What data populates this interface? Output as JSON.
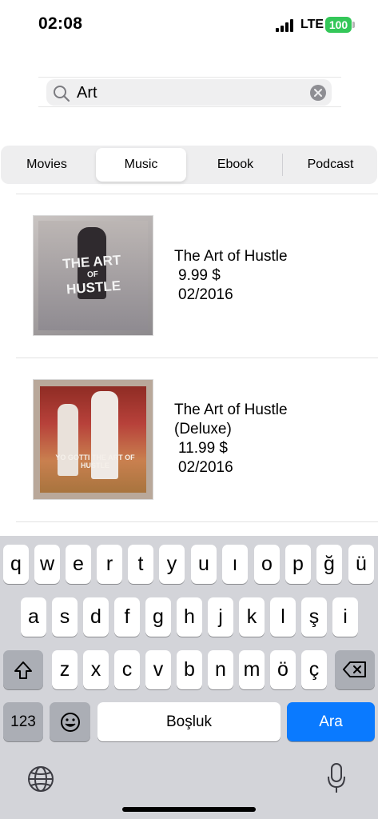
{
  "status_bar": {
    "time": "02:08",
    "network": "LTE",
    "battery": "100",
    "battery_color": "#34c759"
  },
  "search": {
    "value": "Art",
    "icon": "search-icon",
    "clear_icon": "clear-icon"
  },
  "segments": {
    "items": [
      {
        "label": "Movies",
        "selected": false
      },
      {
        "label": "Music",
        "selected": true
      },
      {
        "label": "Ebook",
        "selected": false
      },
      {
        "label": "Podcast",
        "selected": false
      }
    ]
  },
  "results": [
    {
      "title": "The Art of Hustle",
      "price": "9.99 $",
      "date": "02/2016",
      "artwork_text": [
        "THE ART",
        "OF",
        "HUSTLE"
      ]
    },
    {
      "title": "The Art of Hustle",
      "title_line2": "(Deluxe)",
      "price": "11.99 $",
      "date": "02/2016",
      "artwork_text": [
        "YO GOTTI THE ART OF HUSTLE"
      ]
    }
  ],
  "keyboard": {
    "row1": [
      "q",
      "w",
      "e",
      "r",
      "t",
      "y",
      "u",
      "ı",
      "o",
      "p",
      "ğ",
      "ü"
    ],
    "row2": [
      "a",
      "s",
      "d",
      "f",
      "g",
      "h",
      "j",
      "k",
      "l",
      "ş",
      "i"
    ],
    "row3": [
      "z",
      "x",
      "c",
      "v",
      "b",
      "n",
      "m",
      "ö",
      "ç"
    ],
    "numbers_label": "123",
    "space_label": "Boşluk",
    "return_label": "Ara",
    "return_color": "#0a7aff",
    "shift_icon": "shift-icon",
    "delete_icon": "backspace-icon",
    "emoji_icon": "emoji-icon",
    "globe_icon": "globe-icon",
    "mic_icon": "microphone-icon"
  }
}
